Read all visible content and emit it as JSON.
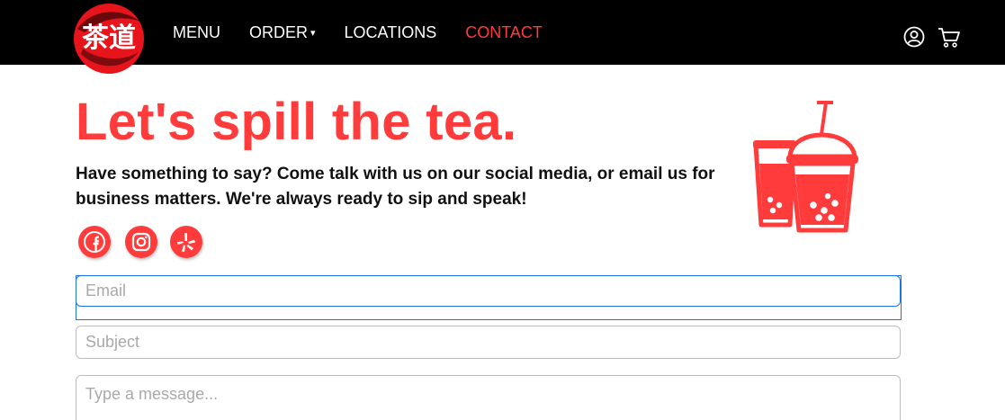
{
  "brand": {
    "logo_icon": "teado-logo-ink-brush",
    "logo_text": "茶道",
    "accent_color": "#ff3b3b"
  },
  "nav": {
    "items": [
      {
        "label": "MENU",
        "active": false,
        "has_dropdown": false
      },
      {
        "label": "ORDER",
        "active": false,
        "has_dropdown": true
      },
      {
        "label": "LOCATIONS",
        "active": false,
        "has_dropdown": false
      },
      {
        "label": "CONTACT",
        "active": true,
        "has_dropdown": false
      }
    ],
    "dropdown_caret": "▾",
    "account_icon": "user-circle-icon",
    "cart_icon": "shopping-cart-icon"
  },
  "contact": {
    "headline": "Let's spill the tea.",
    "intro": "Have something to say? Come talk with us on our social media, or email us for business matters. We're always ready to sip and speak!",
    "social": [
      {
        "name": "facebook-icon"
      },
      {
        "name": "instagram-icon"
      },
      {
        "name": "yelp-icon"
      }
    ],
    "illustration": "bubble-tea-cups-icon"
  },
  "form": {
    "email_placeholder": "Email",
    "email_value": "",
    "subject_placeholder": "Subject",
    "subject_value": "",
    "message_placeholder": "Type a message...",
    "message_value": ""
  }
}
